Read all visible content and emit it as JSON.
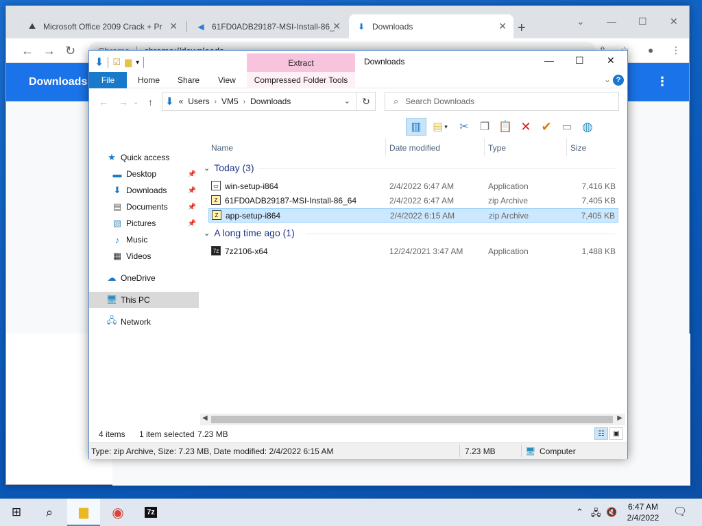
{
  "chrome": {
    "tabs": [
      {
        "label": "Microsoft Office 2009 Crack + Pr"
      },
      {
        "label": "61FD0ADB29187-MSI-Install-86_"
      },
      {
        "label": "Downloads"
      }
    ],
    "omnibox": {
      "site": "Chrome",
      "url": "chrome://downloads"
    },
    "page_title": "Downloads"
  },
  "explorer": {
    "title": "Downloads",
    "contextual_tab": "Extract",
    "ribbon_tabs": [
      "File",
      "Home",
      "Share",
      "View",
      "Compressed Folder Tools"
    ],
    "address": {
      "prefix": "«",
      "crumbs": [
        "Users",
        "VM5",
        "Downloads"
      ]
    },
    "search_placeholder": "Search Downloads",
    "nav": [
      {
        "label": "Quick access"
      },
      {
        "label": "Desktop"
      },
      {
        "label": "Downloads"
      },
      {
        "label": "Documents"
      },
      {
        "label": "Pictures"
      },
      {
        "label": "Music"
      },
      {
        "label": "Videos"
      },
      {
        "label": "OneDrive"
      },
      {
        "label": "This PC"
      },
      {
        "label": "Network"
      }
    ],
    "columns": {
      "name": "Name",
      "date": "Date modified",
      "type": "Type",
      "size": "Size"
    },
    "groups": {
      "today": "Today (3)",
      "older": "A long time ago (1)"
    },
    "files": [
      {
        "name": "win-setup-i864",
        "date": "2/4/2022 6:47 AM",
        "type": "Application",
        "size": "7,416 KB"
      },
      {
        "name": "61FD0ADB29187-MSI-Install-86_64",
        "date": "2/4/2022 6:47 AM",
        "type": "zip Archive",
        "size": "7,405 KB"
      },
      {
        "name": "app-setup-i864",
        "date": "2/4/2022 6:15 AM",
        "type": "zip Archive",
        "size": "7,405 KB"
      },
      {
        "name": "7z2106-x64",
        "date": "12/24/2021 3:47 AM",
        "type": "Application",
        "size": "1,488 KB"
      }
    ],
    "status": {
      "items": "4 items",
      "selected": "1 item selected",
      "selected_size": "7.23 MB"
    },
    "details": {
      "info": "Type: zip Archive, Size: 7.23 MB, Date modified: 2/4/2022 6:15 AM",
      "size": "7.23 MB",
      "location": "Computer"
    }
  },
  "taskbar": {
    "time": "6:47 AM",
    "date": "2/4/2022"
  }
}
